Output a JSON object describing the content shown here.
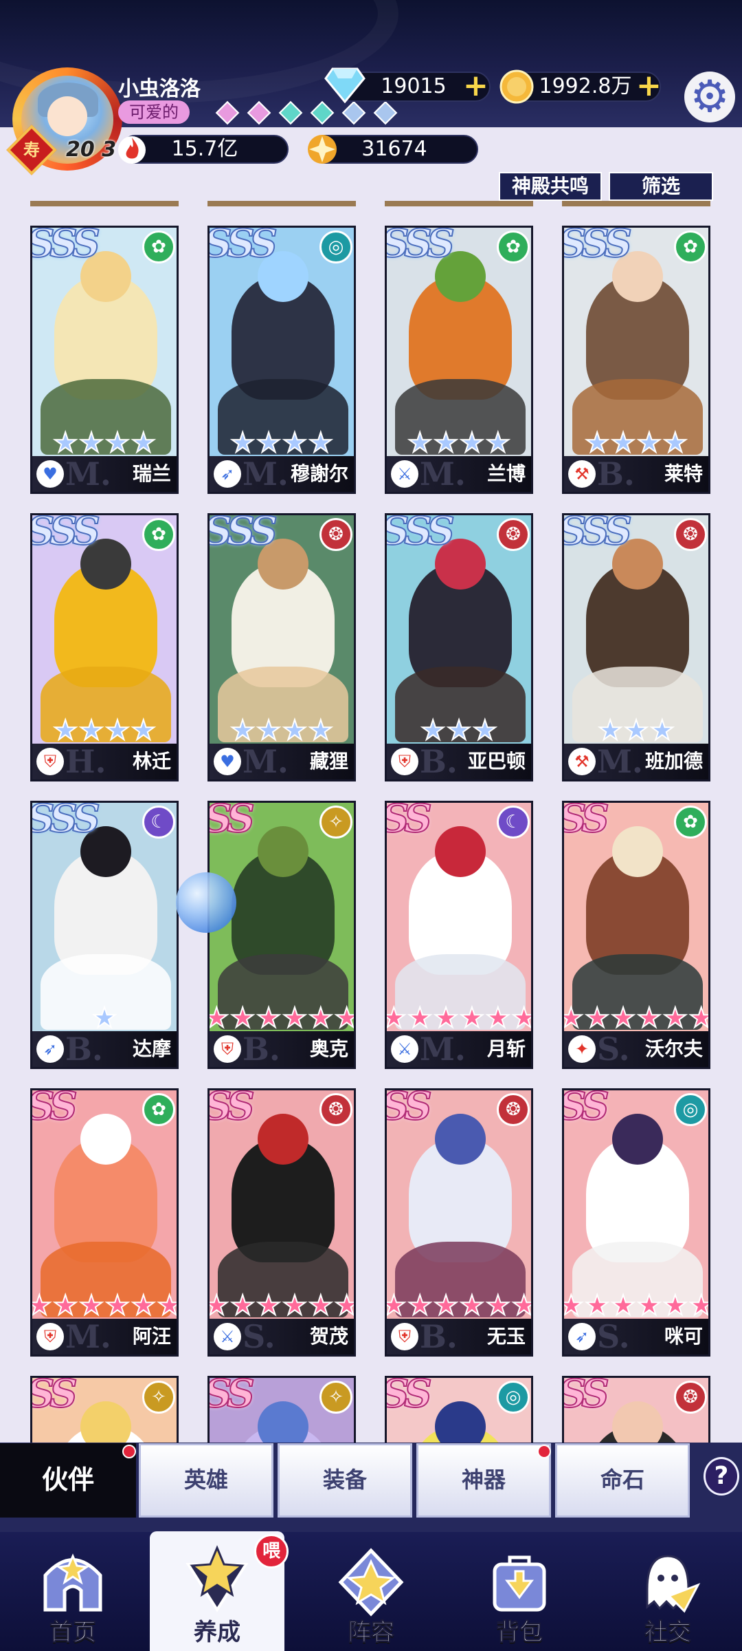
{
  "player": {
    "name": "小虫洛洛",
    "title": "可爱的",
    "badge_char": "寿",
    "vip_mark": "20 3",
    "power": "15.7亿",
    "score": "31674"
  },
  "resources": {
    "diamonds": "19015",
    "gold": "1992.8万"
  },
  "colors": {
    "sss": "#dfe9ff",
    "ss": "#ffb5d6",
    "star_blue": "#a9c9ff",
    "star_pink": "#ff6a9a",
    "faction_green": "#2fae5b",
    "faction_teal": "#1d9aa3",
    "faction_red": "#c2313a",
    "faction_purple": "#6f4bc7",
    "faction_gold": "#c99a22"
  },
  "filters": {
    "temple": "神殿共鸣",
    "filter": "筛选"
  },
  "heroes": [
    {
      "name": "瑞兰",
      "rarity": "SSS",
      "faction": "green",
      "stars": 4,
      "star_color": "blue",
      "tier": "M.",
      "cls": "heart",
      "bg": "#cfe8f4",
      "c1": "#f4e6b5",
      "c2": "#f3d28a",
      "c3": "#4c6a3c"
    },
    {
      "name": "穆謝尔",
      "rarity": "SSS",
      "faction": "teal",
      "stars": 4,
      "star_color": "blue",
      "tier": "M.",
      "cls": "bow",
      "bg": "#9bd0f2",
      "c1": "#2d3346",
      "c2": "#9fd4ff",
      "c3": "#1d2230"
    },
    {
      "name": "兰博",
      "rarity": "SSS",
      "faction": "green",
      "stars": 4,
      "star_color": "blue",
      "tier": "M.",
      "cls": "sword",
      "bg": "#d9e1e8",
      "c1": "#e07a2c",
      "c2": "#64a23a",
      "c3": "#3a3a3a"
    },
    {
      "name": "莱特",
      "rarity": "SSS",
      "faction": "green",
      "stars": 4,
      "star_color": "blue",
      "tier": "B.",
      "cls": "axe",
      "bg": "#e1e6ea",
      "c1": "#7a5a45",
      "c2": "#f1d2b8",
      "c3": "#a76a3a"
    },
    {
      "name": "林迁",
      "rarity": "SSS",
      "faction": "green",
      "stars": 4,
      "star_color": "blue",
      "tier": "H.",
      "cls": "shield",
      "bg": "#d9c9f4",
      "c1": "#f2b91d",
      "c2": "#3a3a3a",
      "c3": "#e8a914"
    },
    {
      "name": "藏狸",
      "rarity": "SSS",
      "faction": "red",
      "stars": 4,
      "star_color": "blue",
      "tier": "M.",
      "cls": "heart",
      "bg": "#5a8a6a",
      "c1": "#f1efe4",
      "c2": "#c89a6a",
      "c3": "#e7c89c"
    },
    {
      "name": "亚巴顿",
      "rarity": "SSS",
      "faction": "red",
      "stars": 3,
      "star_color": "blue",
      "tier": "B.",
      "cls": "shield",
      "bg": "#8fd0e0",
      "c1": "#2b2a38",
      "c2": "#c9314a",
      "c3": "#3a2a28"
    },
    {
      "name": "班加德",
      "rarity": "SSS",
      "faction": "red",
      "stars": 3,
      "star_color": "blue",
      "tier": "M.",
      "cls": "axe",
      "bg": "#d8e2e6",
      "c1": "#4d3a2e",
      "c2": "#c9895a",
      "c3": "#e9e4dc"
    },
    {
      "name": "达摩",
      "rarity": "SSS",
      "faction": "purple",
      "stars": 1,
      "star_color": "blue",
      "tier": "B.",
      "cls": "bow",
      "bg": "#b9d8e8",
      "c1": "#f2f2f2",
      "c2": "#1d1b22",
      "c3": "#ffffff"
    },
    {
      "name": "奥克",
      "rarity": "SS",
      "faction": "gold",
      "stars": 6,
      "star_color": "pink",
      "tier": "B.",
      "cls": "shield",
      "bg": "#7ebc5a",
      "c1": "#2f4a2a",
      "c2": "#6a8f3c",
      "c3": "#3c3c3c"
    },
    {
      "name": "月斩",
      "rarity": "SS",
      "faction": "purple",
      "stars": 6,
      "star_color": "pink",
      "tier": "M.",
      "cls": "sword",
      "bg": "#f3b3b8",
      "c1": "#ffffff",
      "c2": "#c8283a",
      "c3": "#e0e6f0"
    },
    {
      "name": "沃尔夫",
      "rarity": "SS",
      "faction": "green",
      "stars": 6,
      "star_color": "pink",
      "tier": "S.",
      "cls": "fire",
      "bg": "#f6b9b2",
      "c1": "#8a4a34",
      "c2": "#f2e3c8",
      "c3": "#2a3a3a"
    },
    {
      "name": "阿汪",
      "rarity": "SS",
      "faction": "green",
      "stars": 6,
      "star_color": "pink",
      "tier": "M.",
      "cls": "shield",
      "bg": "#f4a6aa",
      "c1": "#f58b6a",
      "c2": "#ffffff",
      "c3": "#e86a2a"
    },
    {
      "name": "贺茂",
      "rarity": "SS",
      "faction": "red",
      "stars": 6,
      "star_color": "pink",
      "tier": "S.",
      "cls": "sword",
      "bg": "#f0a9ae",
      "c1": "#1d1d1d",
      "c2": "#c02a2a",
      "c3": "#2a2a2a"
    },
    {
      "name": "无玉",
      "rarity": "SS",
      "faction": "red",
      "stars": 6,
      "star_color": "pink",
      "tier": "B.",
      "cls": "shield",
      "bg": "#f2b3b5",
      "c1": "#e8eaf6",
      "c2": "#4a5ab0",
      "c3": "#7a3a5a"
    },
    {
      "name": "咪可",
      "rarity": "SS",
      "faction": "teal",
      "stars": 6,
      "star_color": "pink",
      "tier": "S.",
      "cls": "bow",
      "bg": "#f4b2b6",
      "c1": "#ffffff",
      "c2": "#3a2a5a",
      "c3": "#f2f2f2"
    },
    {
      "name": "",
      "rarity": "SS",
      "faction": "gold",
      "stars": 0,
      "star_color": "pink",
      "tier": "",
      "cls": "",
      "bg": "#f6c9a6",
      "c1": "#ffffff",
      "c2": "#f3d06a",
      "c3": "#ffffff"
    },
    {
      "name": "",
      "rarity": "SS",
      "faction": "gold",
      "stars": 0,
      "star_color": "pink",
      "tier": "",
      "cls": "",
      "bg": "#b8a0d8",
      "c1": "#c9b8f0",
      "c2": "#5a7ad0",
      "c3": "#ffffff"
    },
    {
      "name": "",
      "rarity": "SS",
      "faction": "teal",
      "stars": 0,
      "star_color": "pink",
      "tier": "",
      "cls": "",
      "bg": "#f4c8c8",
      "c1": "#f2e25a",
      "c2": "#2a3a8a",
      "c3": "#ffffff"
    },
    {
      "name": "",
      "rarity": "SS",
      "faction": "red",
      "stars": 0,
      "star_color": "pink",
      "tier": "",
      "cls": "",
      "bg": "#f4c0c4",
      "c1": "#2a2a2a",
      "c2": "#f2c8b0",
      "c3": "#ffffff"
    }
  ],
  "subtabs": [
    "伙伴",
    "英雄",
    "装备",
    "神器",
    "命石"
  ],
  "help_label": "?",
  "nav": {
    "items": [
      "首页",
      "养成",
      "阵容",
      "背包",
      "社交"
    ],
    "badge": "喂"
  }
}
